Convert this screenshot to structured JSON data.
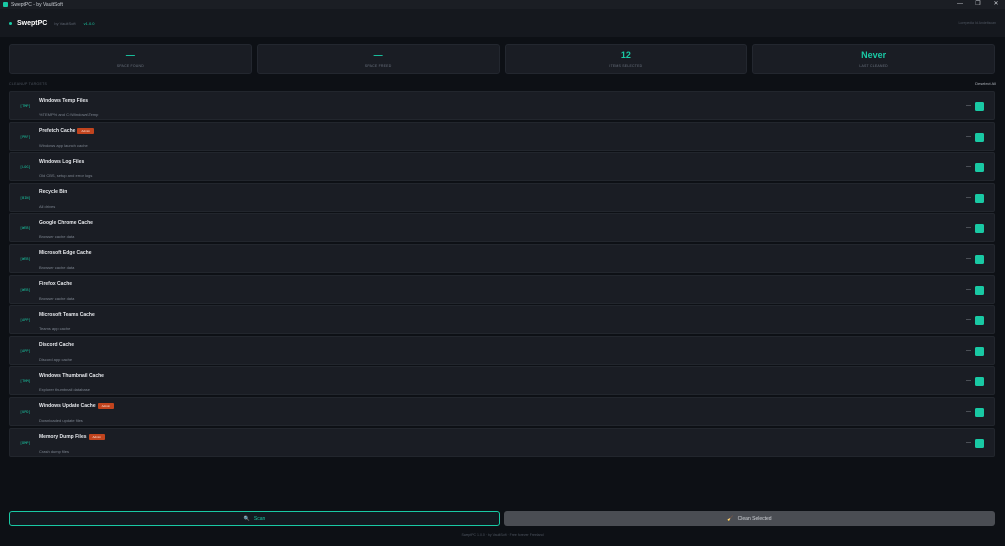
{
  "window": {
    "title": "SweptPC - by VaultSoft",
    "controls": {
      "minimize": "—",
      "maximize": "❐",
      "close": "✕"
    }
  },
  "header": {
    "brand": "SweptPC",
    "by": "by VaultSoft",
    "version": "v1.0.0",
    "right_text": "Lorepedia Id Andeltscan"
  },
  "stats": [
    {
      "value": "—",
      "label": "SPACE FOUND"
    },
    {
      "value": "—",
      "label": "SPACE FREED"
    },
    {
      "value": "12",
      "label": "ITEMS SELECTED"
    },
    {
      "value": "Never",
      "label": "LAST CLEANED"
    }
  ],
  "section": {
    "label": "CLEANUP TARGETS",
    "deselect_label": "Deselect All"
  },
  "items": [
    {
      "size": "[TMP]",
      "name": "Windows Temp Files",
      "admin": "",
      "desc": "%TEMP% and C:\\Windows\\Temp",
      "dash": "—"
    },
    {
      "size": "[PRF]",
      "name": "Prefetch Cache",
      "admin": "Admin",
      "desc": "Windows app launch cache",
      "dash": "—"
    },
    {
      "size": "[LOG]",
      "name": "Windows Log Files",
      "admin": "",
      "desc": "Old CBS, setup and error logs",
      "dash": "—"
    },
    {
      "size": "[BIN]",
      "name": "Recycle Bin",
      "admin": "",
      "desc": "All drives",
      "dash": "—"
    },
    {
      "size": "[WEB]",
      "name": "Google Chrome Cache",
      "admin": "",
      "desc": "Browser cache data",
      "dash": "—"
    },
    {
      "size": "[WEB]",
      "name": "Microsoft Edge Cache",
      "admin": "",
      "desc": "Browser cache data",
      "dash": "—"
    },
    {
      "size": "[WEB]",
      "name": "Firefox Cache",
      "admin": "",
      "desc": "Browser cache data",
      "dash": "—"
    },
    {
      "size": "[APP]",
      "name": "Microsoft Teams Cache",
      "admin": "",
      "desc": "Teams app cache",
      "dash": "—"
    },
    {
      "size": "[APP]",
      "name": "Discord Cache",
      "admin": "",
      "desc": "Discord app cache",
      "dash": "—"
    },
    {
      "size": "[THM]",
      "name": "Windows Thumbnail Cache",
      "admin": "",
      "desc": "Explorer thumbnail database",
      "dash": "—"
    },
    {
      "size": "[UPD]",
      "name": "Windows Update Cache",
      "admin": "Admin",
      "desc": "Downloaded update files",
      "dash": "—"
    },
    {
      "size": "[DMP]",
      "name": "Memory Dump Files",
      "admin": "Admin",
      "desc": "Crash dump files",
      "dash": "—"
    }
  ],
  "actions": {
    "scan_icon": "search-icon",
    "scan_glyph": "🔍",
    "scan_label": "Scan",
    "clean_icon": "broom-icon",
    "clean_glyph": "🧹",
    "clean_label": "Clean Selected"
  },
  "footer": "SweptPC 1.0.0 · by VaultSoft · Free forever Freeland",
  "colors": {
    "accent": "#19c9a4",
    "admin_badge": "#c1441e",
    "background": "#0d1015",
    "card": "#1a1d24"
  }
}
